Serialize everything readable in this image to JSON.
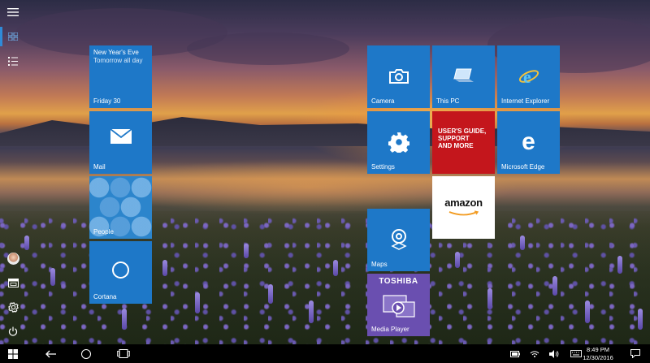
{
  "rail": {
    "items": [
      "hamburger-icon",
      "tiles-icon",
      "all-apps-icon",
      "user-avatar",
      "file-explorer-icon",
      "settings-icon",
      "power-icon"
    ]
  },
  "tiles": {
    "calendar": {
      "event": "New Year's Eve",
      "detail": "Tomorrow all day",
      "label": "Friday 30"
    },
    "mail": {
      "label": "Mail"
    },
    "people": {
      "label": "People"
    },
    "cortana": {
      "label": "Cortana"
    },
    "camera": {
      "label": "Camera"
    },
    "thispc": {
      "label": "This PC"
    },
    "ie": {
      "label": "Internet Explorer"
    },
    "settings": {
      "label": "Settings"
    },
    "guide": {
      "line1": "USER'S GUIDE,",
      "line2": "SUPPORT",
      "line3": "AND MORE"
    },
    "edge": {
      "label": "Microsoft Edge"
    },
    "amazon": {
      "label": "amazon"
    },
    "maps": {
      "label": "Maps"
    },
    "mediaplayer": {
      "brand": "TOSHIBA",
      "label": "Media Player"
    }
  },
  "colors": {
    "tile_blue": "#1e78c8",
    "guide_red": "#c4161c",
    "toshiba_purple": "#6a4fb0",
    "accent": "#2f8bd8"
  },
  "taskbar": {
    "time": "8:49 PM",
    "date": "12/30/2016"
  }
}
